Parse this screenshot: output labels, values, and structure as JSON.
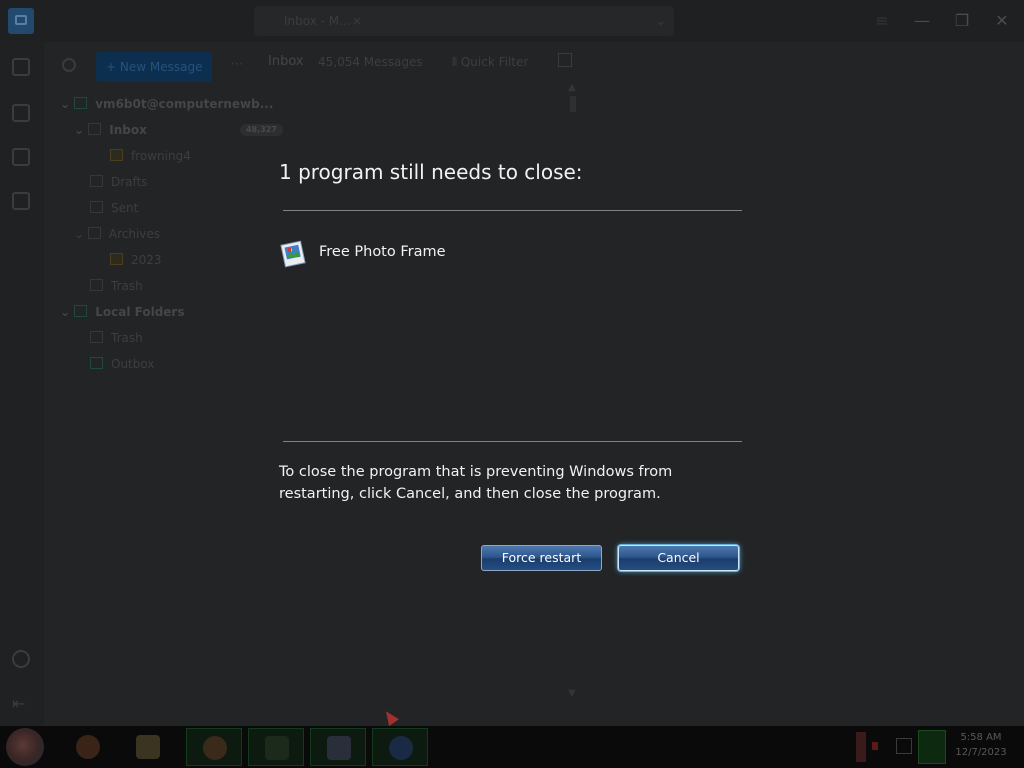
{
  "dialog": {
    "heading": "1 program still needs to close:",
    "programs": [
      {
        "name": "Free Photo Frame",
        "icon": "photo-frame-icon"
      }
    ],
    "message": "To close the program that is preventing Windows from restarting, click Cancel, and then close the program.",
    "buttons": {
      "force_restart": "Force restart",
      "cancel": "Cancel"
    },
    "colors": {
      "text": "#f2f2f2",
      "button": "#2e578d",
      "focus_glow": "#53b6f0"
    }
  },
  "background_app": {
    "tab_title": "Inbox - M...",
    "new_message_label": "New Message",
    "folders": [
      {
        "label": "vm6b0t@computernewb...",
        "level": 0
      },
      {
        "label": "Inbox",
        "level": 1
      },
      {
        "label": "frowning4",
        "level": 2
      },
      {
        "label": "Drafts",
        "level": 1
      },
      {
        "label": "Sent",
        "level": 1
      },
      {
        "label": "Archives",
        "level": 1
      },
      {
        "label": "2023",
        "level": 2
      },
      {
        "label": "Trash",
        "level": 1
      },
      {
        "label": "Local Folders",
        "level": 0
      },
      {
        "label": "Trash",
        "level": 1
      },
      {
        "label": "Outbox",
        "level": 1
      }
    ],
    "inbox_badge": "48,327",
    "thread_header": {
      "folder": "Inbox",
      "count": "45,054 Messages",
      "quick_filter": "Quick Filter"
    }
  },
  "taskbar": {
    "clock_time": "5:58 AM",
    "clock_date": "12/7/2023"
  }
}
